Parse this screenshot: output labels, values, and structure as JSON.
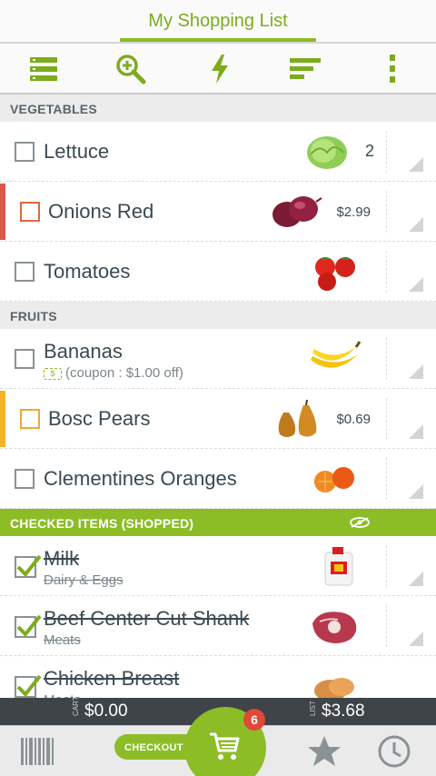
{
  "header": {
    "title": "My Shopping List"
  },
  "toolbar": {
    "icons": [
      "list-view-icon",
      "zoom-in-icon",
      "flash-icon",
      "sort-icon",
      "more-vert-icon"
    ]
  },
  "sections": {
    "vegetables": "VEGETABLES",
    "fruits": "FRUITS",
    "checked": "CHECKED ITEMS (SHOPPED)"
  },
  "items": {
    "lettuce": {
      "name": "Lettuce",
      "qty": "2"
    },
    "onions": {
      "name": "Onions Red",
      "price": "$2.99"
    },
    "tomatoes": {
      "name": "Tomatoes"
    },
    "bananas": {
      "name": "Bananas",
      "coupon": "(coupon : $1.00 off)",
      "coupon_icon": "$"
    },
    "pears": {
      "name": "Bosc Pears",
      "price": "$0.69"
    },
    "clementines": {
      "name": "Clementines Oranges"
    },
    "milk": {
      "name": "Milk",
      "category": "Dairy & Eggs"
    },
    "beef": {
      "name": "Beef Center Cut Shank",
      "category": "Meats"
    },
    "chicken": {
      "name": "Chicken Breast",
      "category": "Meats"
    }
  },
  "totals": {
    "cart_label": "CART",
    "cart_value": "$0.00",
    "list_label": "LIST",
    "list_value": "$3.68"
  },
  "bottom_nav": {
    "checkout_label": "CHECKOUT ▸",
    "cart_badge": "6",
    "icons": [
      "barcode-icon",
      "cart-icon",
      "star-icon",
      "clock-icon"
    ]
  },
  "colors": {
    "accent": "#8cbd27",
    "onion_marker": "#d9584a",
    "pear_marker": "#f5b325"
  }
}
